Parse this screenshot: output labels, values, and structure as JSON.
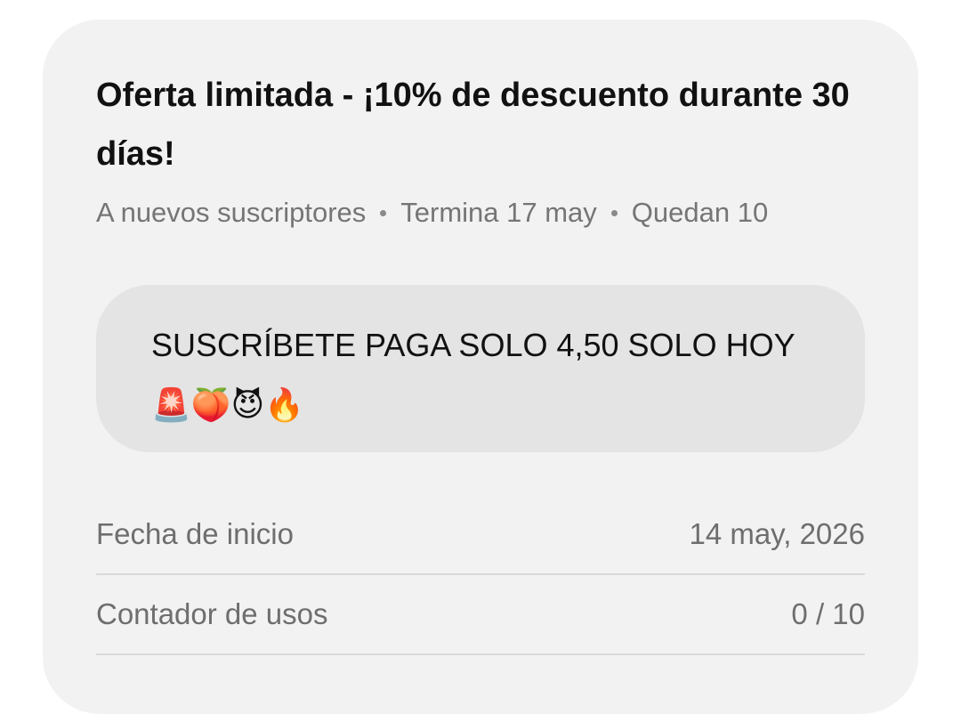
{
  "offer": {
    "title": "Oferta limitada - ¡10% de descuento durante 30 días!",
    "meta": {
      "audience": "A nuevos suscriptores",
      "ends": "Termina 17 may",
      "remaining": "Quedan 10"
    },
    "message": "SUSCRÍBETE PAGA SOLO 4,50 SOLO HOY 🚨🍑😈🔥",
    "details": [
      {
        "label": "Fecha de inicio",
        "value": "14 may, 2026"
      },
      {
        "label": "Contador de usos",
        "value": "0 / 10"
      }
    ]
  },
  "colors": {
    "card_background": "#f2f2f2",
    "message_background": "#e4e4e4",
    "title_text": "#111111",
    "secondary_text": "#757575",
    "divider": "#d9d9d9"
  }
}
